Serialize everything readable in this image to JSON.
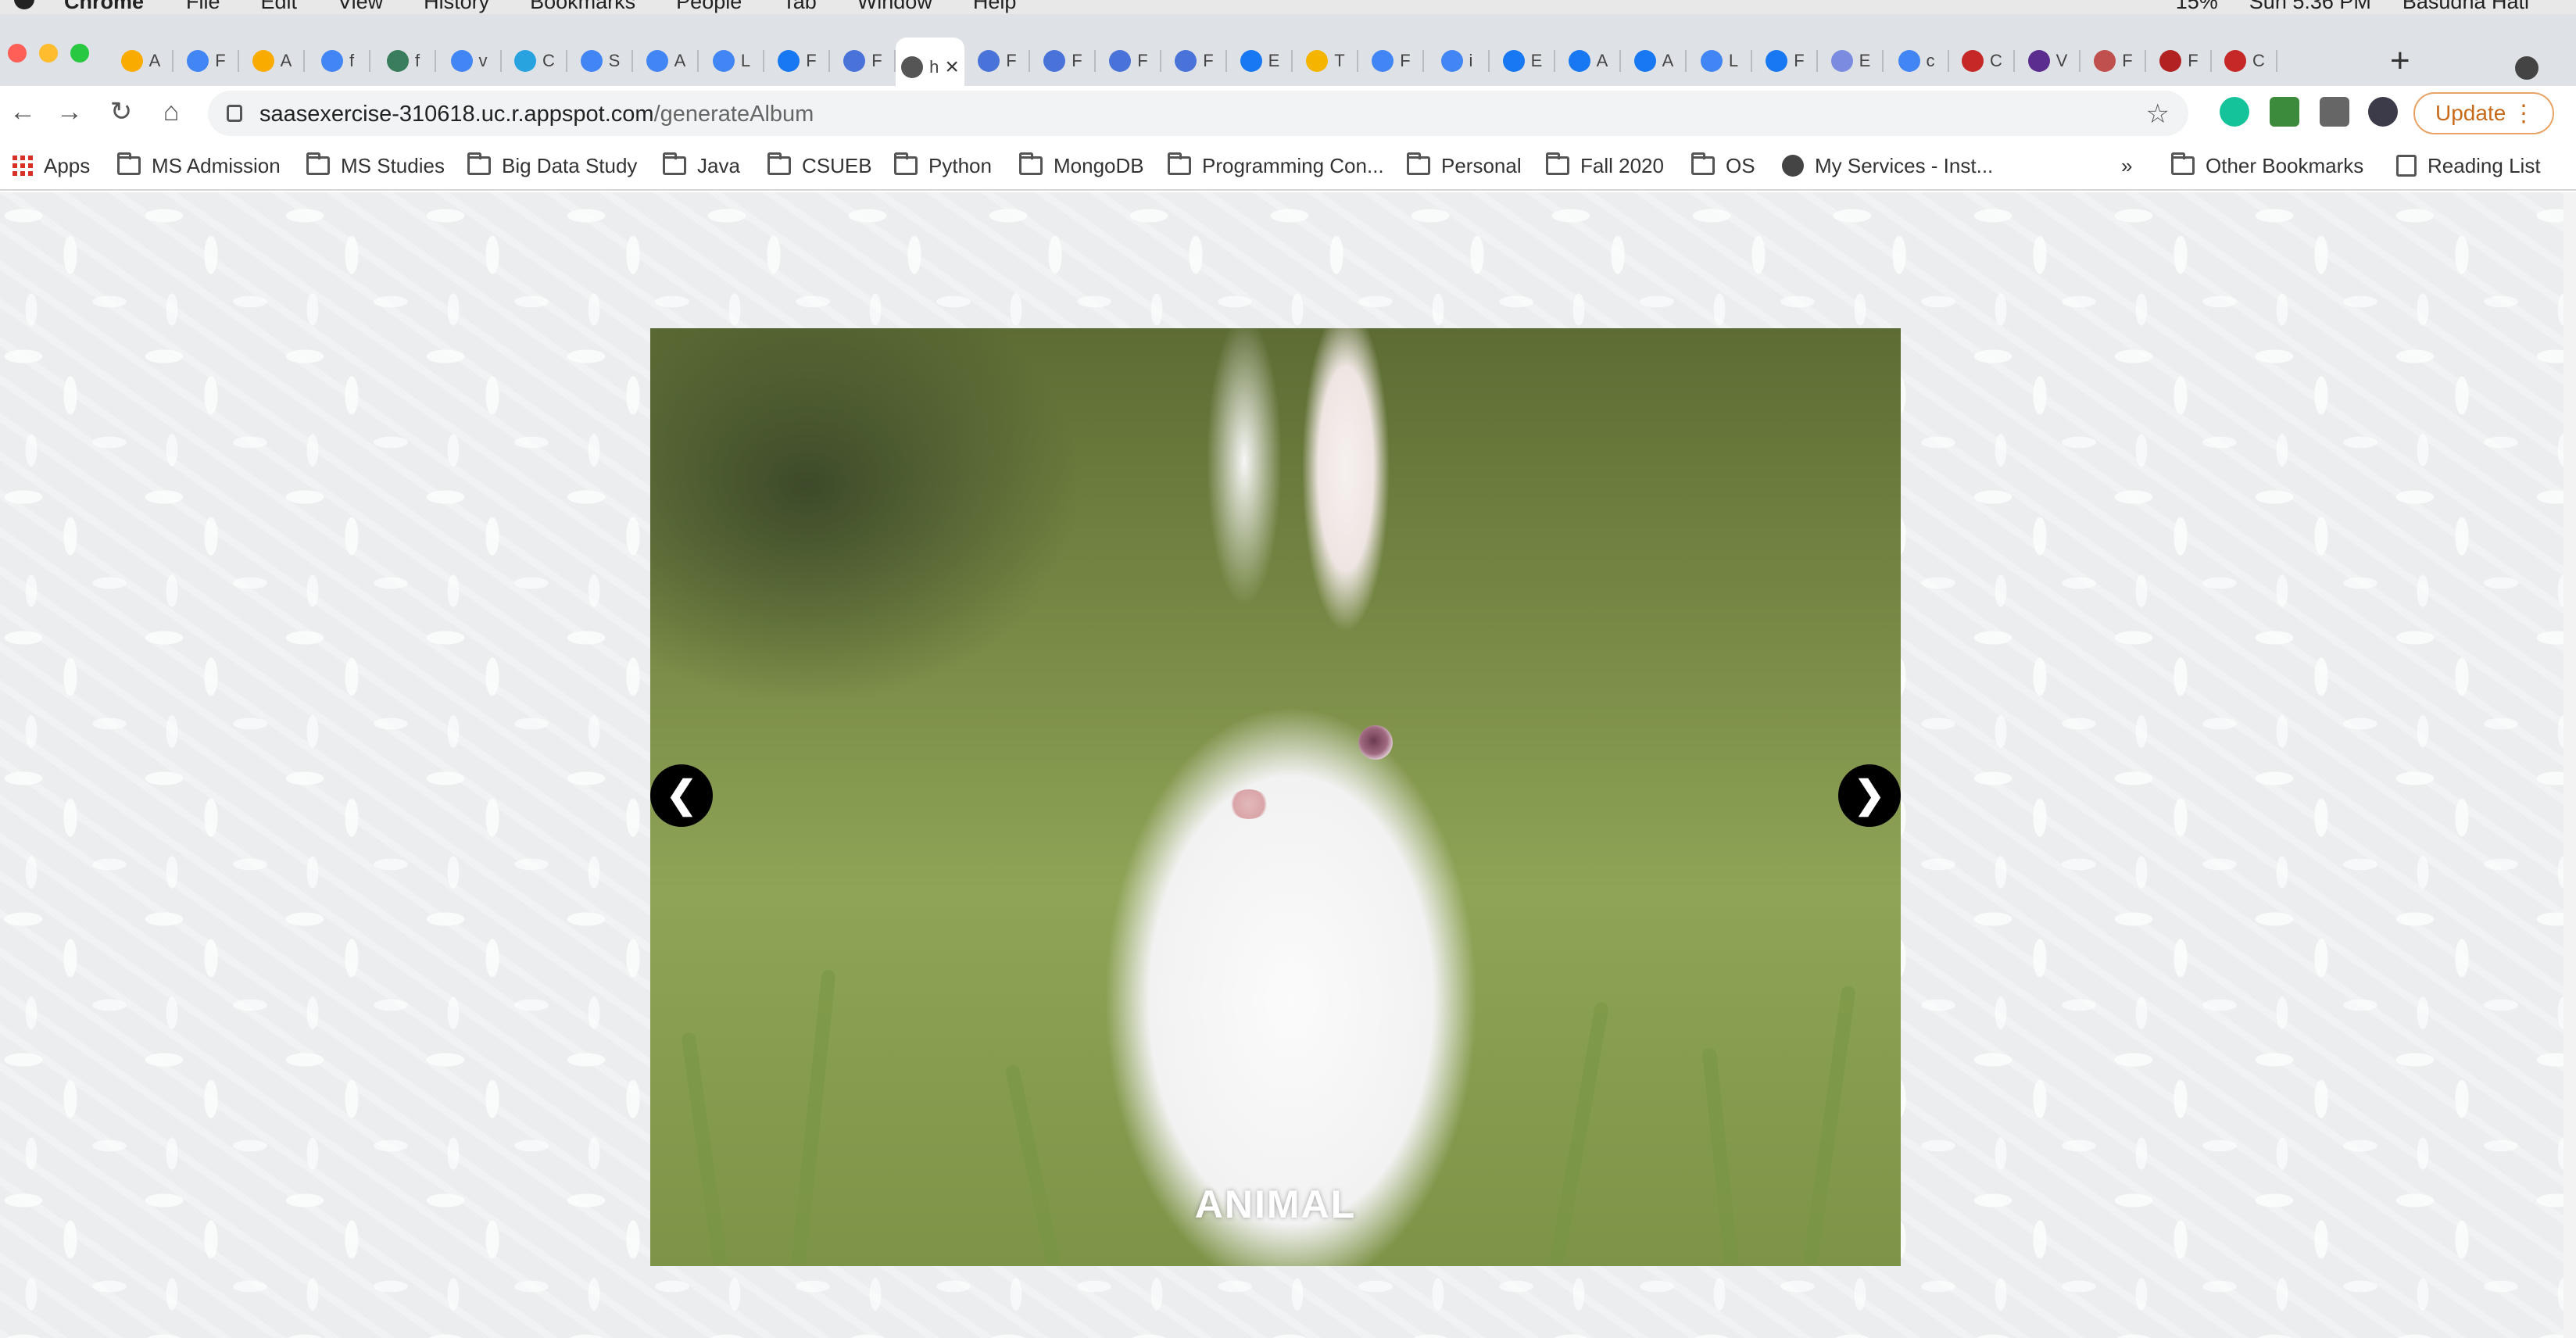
{
  "menubar": {
    "app_name": "Chrome",
    "menus": [
      "File",
      "Edit",
      "View",
      "History",
      "Bookmarks",
      "People",
      "Tab",
      "Window",
      "Help"
    ],
    "battery": "15%",
    "time": "Sun 5:36 PM",
    "user": "Basudha Hati"
  },
  "tabs": [
    {
      "icon": "analytics-icon",
      "label": "A",
      "color": "#f9ab00"
    },
    {
      "icon": "chrome-icon",
      "label": "F",
      "color": "#4285f4"
    },
    {
      "icon": "analytics-icon",
      "label": "A",
      "color": "#f9ab00"
    },
    {
      "icon": "google-icon",
      "label": "f",
      "color": "#4285f4"
    },
    {
      "icon": "moon-icon",
      "label": "f",
      "color": "#3a7d5c"
    },
    {
      "icon": "google-icon",
      "label": "v",
      "color": "#4285f4"
    },
    {
      "icon": "d-icon",
      "label": "C",
      "color": "#29a3e0"
    },
    {
      "icon": "google-icon",
      "label": "S",
      "color": "#4285f4"
    },
    {
      "icon": "google-icon",
      "label": "A",
      "color": "#4285f4"
    },
    {
      "icon": "google-icon",
      "label": "L",
      "color": "#4285f4"
    },
    {
      "icon": "facebook-icon",
      "label": "F",
      "color": "#1877f2"
    },
    {
      "icon": "cloud-shield-icon",
      "label": "F",
      "color": "#4a73d9"
    },
    {
      "icon": "text-icon",
      "label": "h",
      "color": "#555555",
      "active": true
    },
    {
      "icon": "cloud-shield-icon",
      "label": "F",
      "color": "#4a73d9"
    },
    {
      "icon": "cloud-shield-icon",
      "label": "F",
      "color": "#4a73d9"
    },
    {
      "icon": "cloud-shield-icon",
      "label": "F",
      "color": "#4a73d9"
    },
    {
      "icon": "cloud-shield-icon",
      "label": "F",
      "color": "#4a73d9"
    },
    {
      "icon": "facebook-icon",
      "label": "E",
      "color": "#1877f2"
    },
    {
      "icon": "google-cloud-icon",
      "label": "T",
      "color": "#f4b400"
    },
    {
      "icon": "google-icon",
      "label": "F",
      "color": "#4285f4"
    },
    {
      "icon": "google-icon",
      "label": "i",
      "color": "#4285f4"
    },
    {
      "icon": "facebook-icon",
      "label": "E",
      "color": "#1877f2"
    },
    {
      "icon": "facebook-icon",
      "label": "A",
      "color": "#1877f2"
    },
    {
      "icon": "facebook-icon",
      "label": "A",
      "color": "#1877f2"
    },
    {
      "icon": "google-icon",
      "label": "L",
      "color": "#4285f4"
    },
    {
      "icon": "facebook-icon",
      "label": "F",
      "color": "#1877f2"
    },
    {
      "icon": "people-icon",
      "label": "E",
      "color": "#7b8ce0"
    },
    {
      "icon": "google-icon",
      "label": "c",
      "color": "#4285f4"
    },
    {
      "icon": "mgr-icon",
      "label": "C",
      "color": "#c62828"
    },
    {
      "icon": "s-icon",
      "label": "V",
      "color": "#5b2d8e"
    },
    {
      "icon": "leaf-icon",
      "label": "F",
      "color": "#c0504d"
    },
    {
      "icon": "chart-icon",
      "label": "F",
      "color": "#b22222"
    },
    {
      "icon": "mgr-icon",
      "label": "C",
      "color": "#c62828"
    }
  ],
  "toolbar": {
    "url_host": "saasexercise-310618.uc.r.appspot.com",
    "url_path": "/generateAlbum",
    "update_label": "Update"
  },
  "bookmarks": {
    "items": [
      "Apps",
      "MS Admission",
      "MS Studies",
      "Big Data Study",
      "Java",
      "CSUEB",
      "Python",
      "MongoDB",
      "Programming Con...",
      "Personal",
      "Fall 2020",
      "OS",
      "My Services - Inst..."
    ],
    "overflow": "»",
    "other": "Other Bookmarks",
    "reading_list": "Reading List"
  },
  "slideshow": {
    "caption": "ANIMAL",
    "prev": "❮",
    "next": "❯"
  },
  "colors": {
    "accent_update": "#c76a1c",
    "arrow_bg": "#000000"
  }
}
